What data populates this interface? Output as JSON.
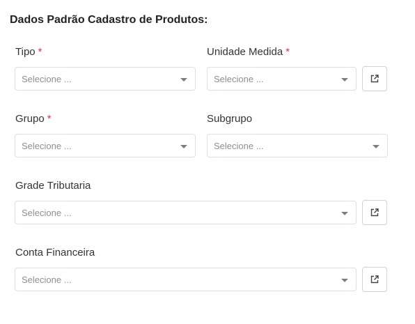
{
  "section": {
    "title": "Dados Padrão Cadastro de Produtos:"
  },
  "fields": {
    "tipo": {
      "label": "Tipo",
      "required_mark": "*",
      "placeholder": "Selecione ..."
    },
    "unidade_medida": {
      "label": "Unidade Medida",
      "required_mark": "*",
      "placeholder": "Selecione ..."
    },
    "grupo": {
      "label": "Grupo",
      "required_mark": "*",
      "placeholder": "Selecione ..."
    },
    "subgrupo": {
      "label": "Subgrupo",
      "placeholder": "Selecione ..."
    },
    "grade_tributaria": {
      "label": "Grade Tributaria",
      "placeholder": "Selecione ..."
    },
    "conta_financeira": {
      "label": "Conta Financeira",
      "placeholder": "Selecione ..."
    }
  },
  "icons": {
    "external_link": "external-link-icon",
    "dropdown": "chevron-down-icon"
  },
  "colors": {
    "required": "#dc3545",
    "border": "#dcdfe4",
    "placeholder": "#8a8f98"
  }
}
